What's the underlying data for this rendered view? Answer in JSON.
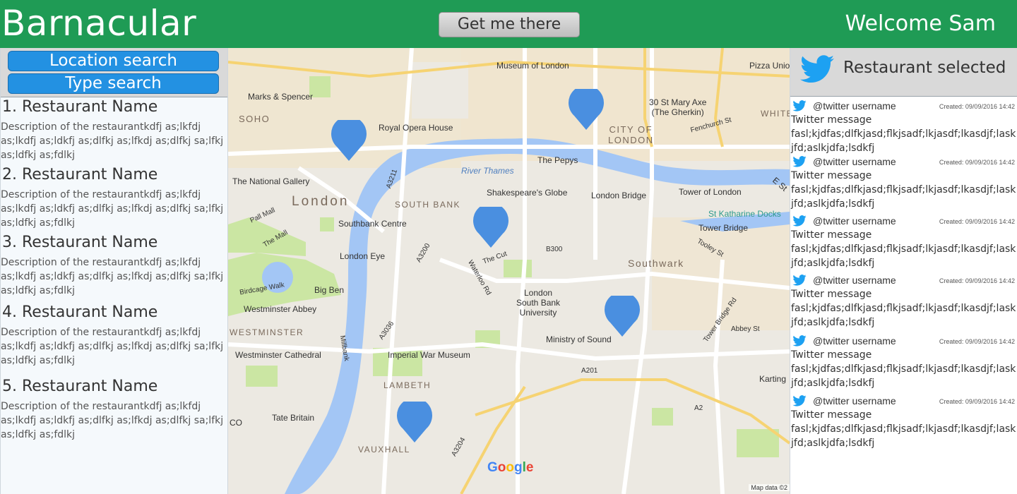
{
  "header": {
    "brand": "Barnacular",
    "go_button": "Get me there",
    "welcome": "Welcome Sam"
  },
  "search": {
    "location_label": "Location search",
    "type_label": "Type search"
  },
  "restaurants": [
    {
      "name": "1. Restaurant Name",
      "description": "Description of the restaurantkdfj as;lkfdj as;lkdfj as;ldkfj as;dlfkj as;lfkdj as;dlfkj sa;lfkj as;ldfkj as;fdlkj"
    },
    {
      "name": "2. Restaurant Name",
      "description": "Description of the restaurantkdfj as;lkfdj as;lkdfj as;ldkfj as;dlfkj as;lfkdj as;dlfkj sa;lfkj as;ldfkj as;fdlkj"
    },
    {
      "name": "3. Restaurant Name",
      "description": "Description of the restaurantkdfj as;lkfdj as;lkdfj as;ldkfj as;dlfkj as;lfkdj as;dlfkj sa;lfkj as;ldfkj as;fdlkj"
    },
    {
      "name": "4. Restaurant Name",
      "description": "Description of the restaurantkdfj as;lkfdj as;lkdfj as;ldkfj as;dlfkj as;lfkdj as;dlfkj sa;lfkj as;ldfkj as;fdlkj"
    },
    {
      "name": "5. Restaurant Name",
      "description": "Description of the restaurantkdfj as;lkfdj as;lkdfj as;ldkfj as;dlfkj as;lfkdj as;dlfkj sa;lfkj as;ldfkj as;fdlkj"
    }
  ],
  "map": {
    "labels": {
      "museum_of_london": "Museum of London",
      "pizza_union": "Pizza Union",
      "marks_spencer": "Marks & Spencer",
      "soho": "SOHO",
      "royal_opera_house": "Royal Opera House",
      "gherkin": "30 St Mary Axe\n(The Gherkin)",
      "city_of_london": "CITY OF\nLONDON",
      "fenchurch": "Fenchurch St",
      "the_pepys": "The Pepys",
      "river_thames": "River Thames",
      "national_gallery": "The National Gallery",
      "london": "London",
      "south_bank": "SOUTH BANK",
      "shakespeares_globe": "Shakespeare's Globe",
      "london_bridge": "London Bridge",
      "tower_of_london": "Tower of London",
      "st_katharine_docks": "St Katharine Docks",
      "pall_mall": "Pall Mall",
      "southbank_centre": "Southbank Centre",
      "tower_bridge": "Tower Bridge",
      "the_mall": "The Mall",
      "london_eye": "London Eye",
      "the_cut": "The Cut",
      "b300": "B300",
      "southwark": "Southwark",
      "tooley_st": "Tooley St",
      "birdcage_walk": "Birdcage Walk",
      "big_ben": "Big Ben",
      "lsbu": "London\nSouth Bank\nUniversity",
      "westminster_abbey": "Westminster Abbey",
      "westminster": "WESTMINSTER",
      "ministry_of_sound": "Ministry of Sound",
      "abbey_st": "Abbey St",
      "westminster_cathedral": "Westminster Cathedral",
      "imperial_war_museum": "Imperial War Museum",
      "lambeth": "LAMBETH",
      "tate_britain": "Tate Britain",
      "vauxhall": "VAUXHALL",
      "a201": "A201",
      "a2": "A2",
      "karting": "Karting",
      "co": "CO",
      "whitechapel": "WHITE",
      "e_st": "E St",
      "tower_bridge_rd": "Tower Bridge Rd",
      "waterloo_rd": "Waterloo Rd",
      "a3200": "A3200",
      "a3036": "A3036",
      "millbank": "Millbank",
      "a3204": "A3204",
      "a3211": "A3211"
    },
    "google_letters": [
      "G",
      "o",
      "o",
      "g",
      "l",
      "e"
    ],
    "google_colors": [
      "#4285f4",
      "#ea4335",
      "#fbbc05",
      "#4285f4",
      "#34a853",
      "#ea4335"
    ],
    "map_data": "Map data ©2",
    "water_color": "#a3c6f5",
    "pin_color": "#4a8fe0"
  },
  "twitter": {
    "title": "Restaurant selected",
    "tweets": [
      {
        "username": "@twitter username",
        "created": "Created: 09/09/2016 14:42",
        "message_title": "Twitter message",
        "body": "fasl;kjdfas;dlfkjasd;flkjsadf;lkjasdf;lkasdjf;laskjfd;aslkjdfa;lsdkfj"
      },
      {
        "username": "@twitter username",
        "created": "Created: 09/09/2016 14:42",
        "message_title": "Twitter message",
        "body": "fasl;kjdfas;dlfkjasd;flkjsadf;lkjasdf;lkasdjf;laskjfd;aslkjdfa;lsdkfj"
      },
      {
        "username": "@twitter username",
        "created": "Created: 09/09/2016 14:42",
        "message_title": "Twitter message",
        "body": "fasl;kjdfas;dlfkjasd;flkjsadf;lkjasdf;lkasdjf;laskjfd;aslkjdfa;lsdkfj"
      },
      {
        "username": "@twitter username",
        "created": "Created: 09/09/2016 14:42",
        "message_title": "Twitter message",
        "body": "fasl;kjdfas;dlfkjasd;flkjsadf;lkjasdf;lkasdjf;laskjfd;aslkjdfa;lsdkfj"
      },
      {
        "username": "@twitter username",
        "created": "Created: 09/09/2016 14:42",
        "message_title": "Twitter message",
        "body": "fasl;kjdfas;dlfkjasd;flkjsadf;lkjasdf;lkasdjf;laskjfd;aslkjdfa;lsdkfj"
      },
      {
        "username": "@twitter username",
        "created": "Created: 09/09/2016 14:42",
        "message_title": "Twitter message",
        "body": "fasl;kjdfas;dlfkjasd;flkjsadf;lkjasdf;lkasdjf;laskjfd;aslkjdfa;lsdkfj"
      }
    ]
  },
  "colors": {
    "header_bg": "#1f9b55",
    "accent": "#2391e2",
    "twitter_blue": "#1da1f2"
  }
}
